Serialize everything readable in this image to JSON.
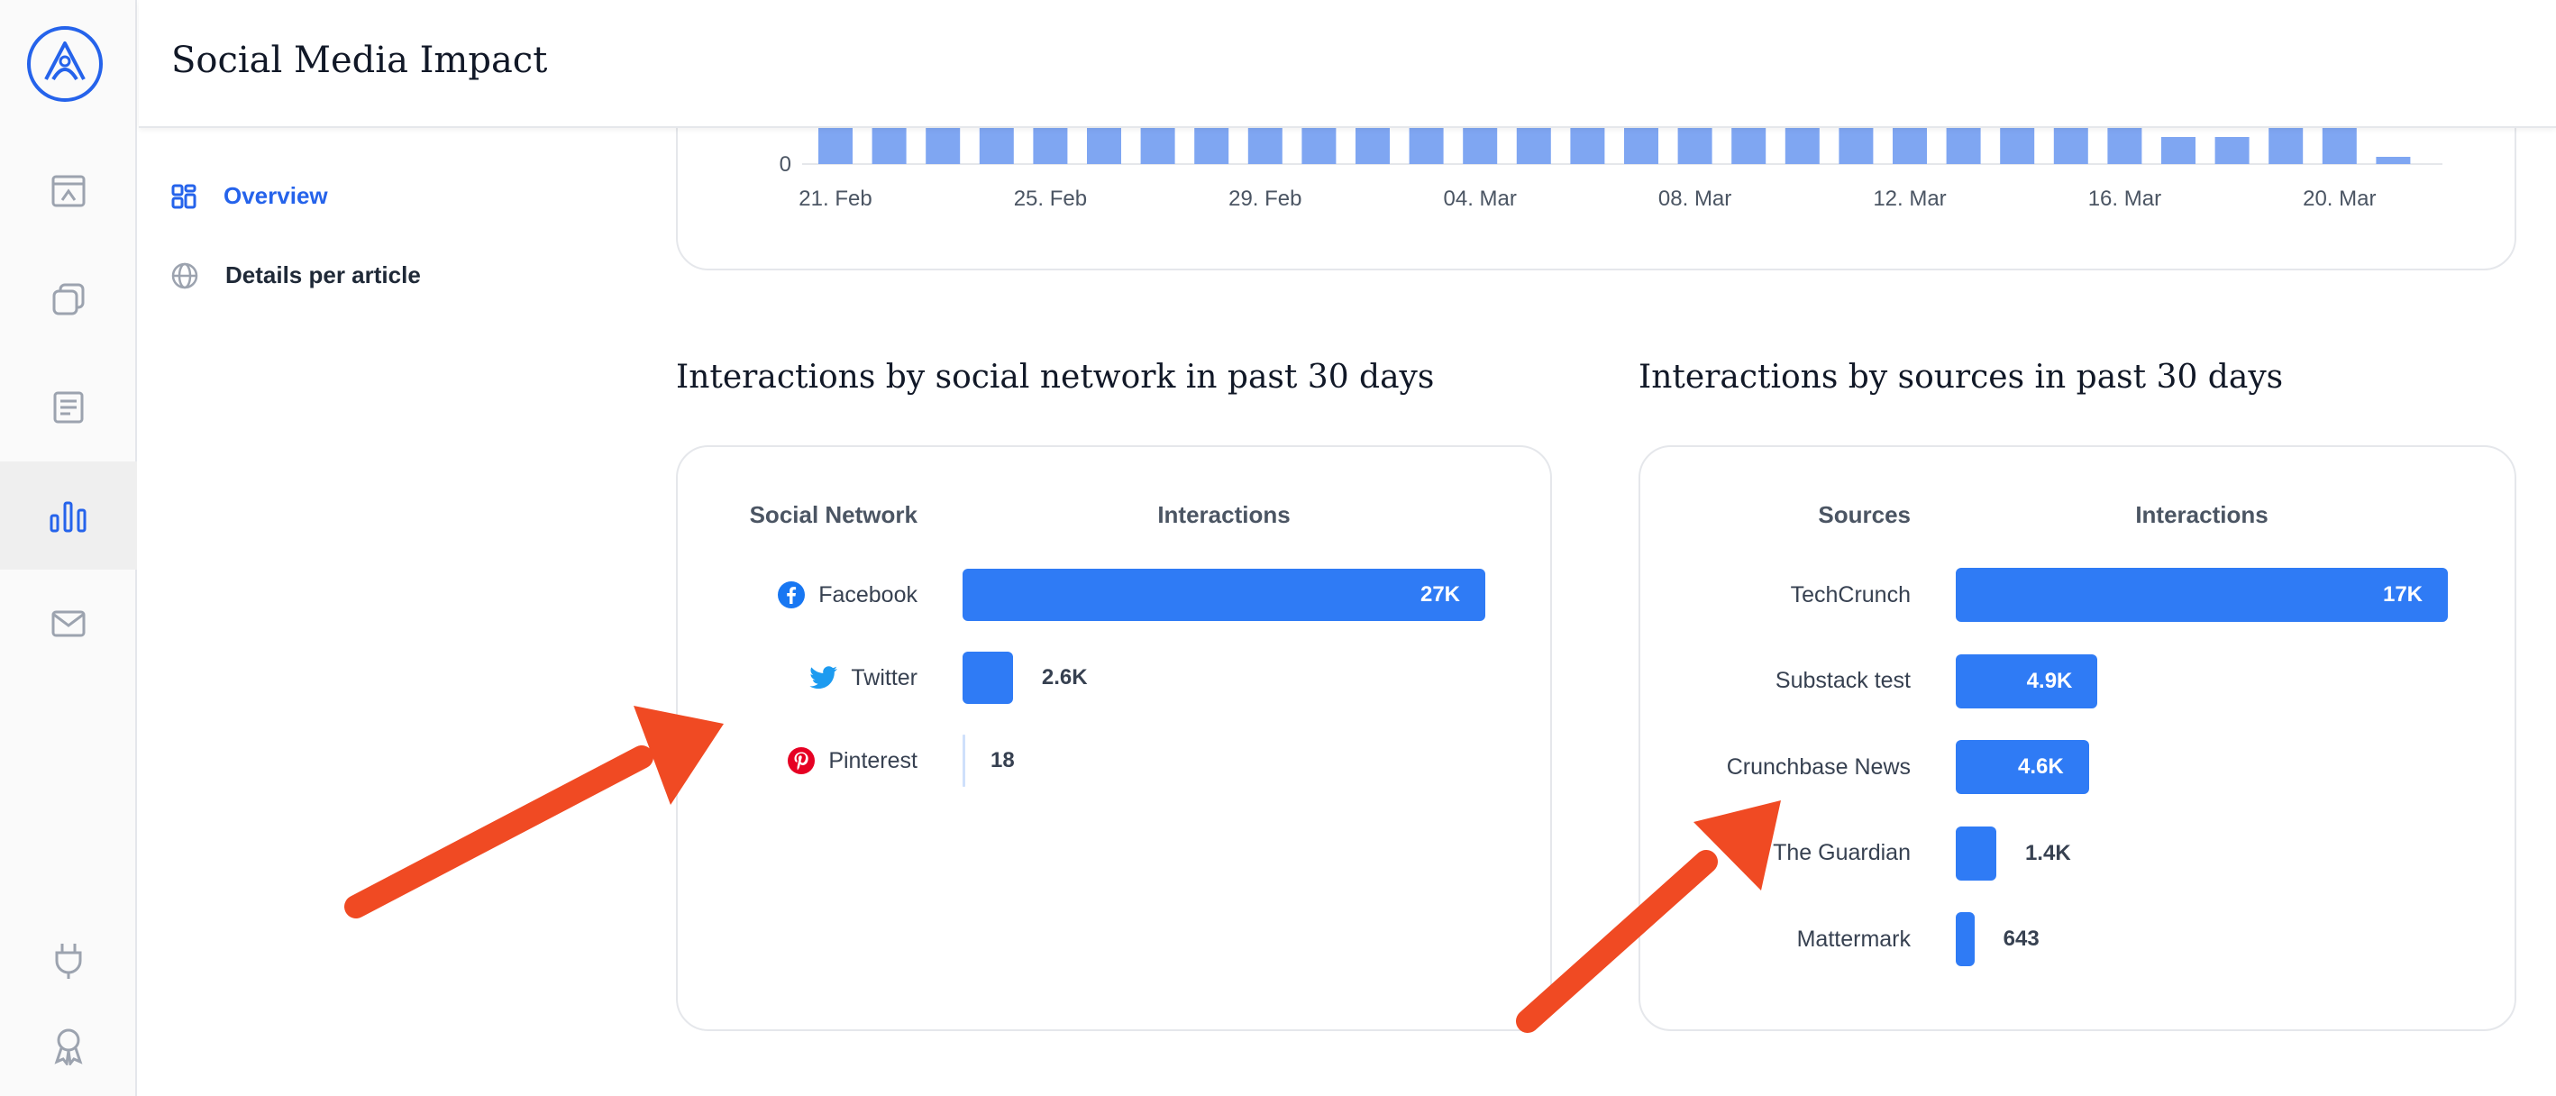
{
  "header": {
    "title": "Social Media Impact"
  },
  "subnav": {
    "items": [
      {
        "label": "Overview",
        "icon": "dashboard-icon",
        "active": true
      },
      {
        "label": "Details per article",
        "icon": "globe-icon",
        "active": false
      }
    ]
  },
  "rail": {
    "icons": [
      "app-logo",
      "layout-icon",
      "copy-icon",
      "article-icon",
      "bar-chart-icon",
      "mail-icon",
      "plug-icon",
      "award-icon"
    ]
  },
  "colors": {
    "accent": "#2563eb",
    "bar": "#2f7bf5",
    "top_bar": "#7fa6f2",
    "arrow": "#f04a23"
  },
  "top_chart": {
    "chart_data": {
      "type": "bar",
      "y_tick": "0",
      "x_ticks": [
        "21. Feb",
        "25. Feb",
        "29. Feb",
        "04. Mar",
        "08. Mar",
        "12. Mar",
        "16. Mar",
        "20. Mar"
      ]
    }
  },
  "social": {
    "title": "Interactions by social network in past 30 days",
    "col_label": "Social Network",
    "col_value": "Interactions",
    "chart_data": {
      "type": "bar",
      "orientation": "horizontal",
      "categories": [
        "Facebook",
        "Twitter",
        "Pinterest"
      ],
      "values": [
        27000,
        2600,
        18
      ],
      "data_labels": [
        "27K",
        "2.6K",
        "18"
      ],
      "icons": [
        "facebook-icon",
        "twitter-icon",
        "pinterest-icon"
      ]
    }
  },
  "sources": {
    "title": "Interactions by sources in past 30 days",
    "col_label": "Sources",
    "col_value": "Interactions",
    "chart_data": {
      "type": "bar",
      "orientation": "horizontal",
      "categories": [
        "TechCrunch",
        "Substack test",
        "Crunchbase News",
        "The Guardian",
        "Mattermark"
      ],
      "values": [
        17000,
        4900,
        4600,
        1400,
        643
      ],
      "data_labels": [
        "17K",
        "4.9K",
        "4.6K",
        "1.4K",
        "643"
      ]
    }
  }
}
